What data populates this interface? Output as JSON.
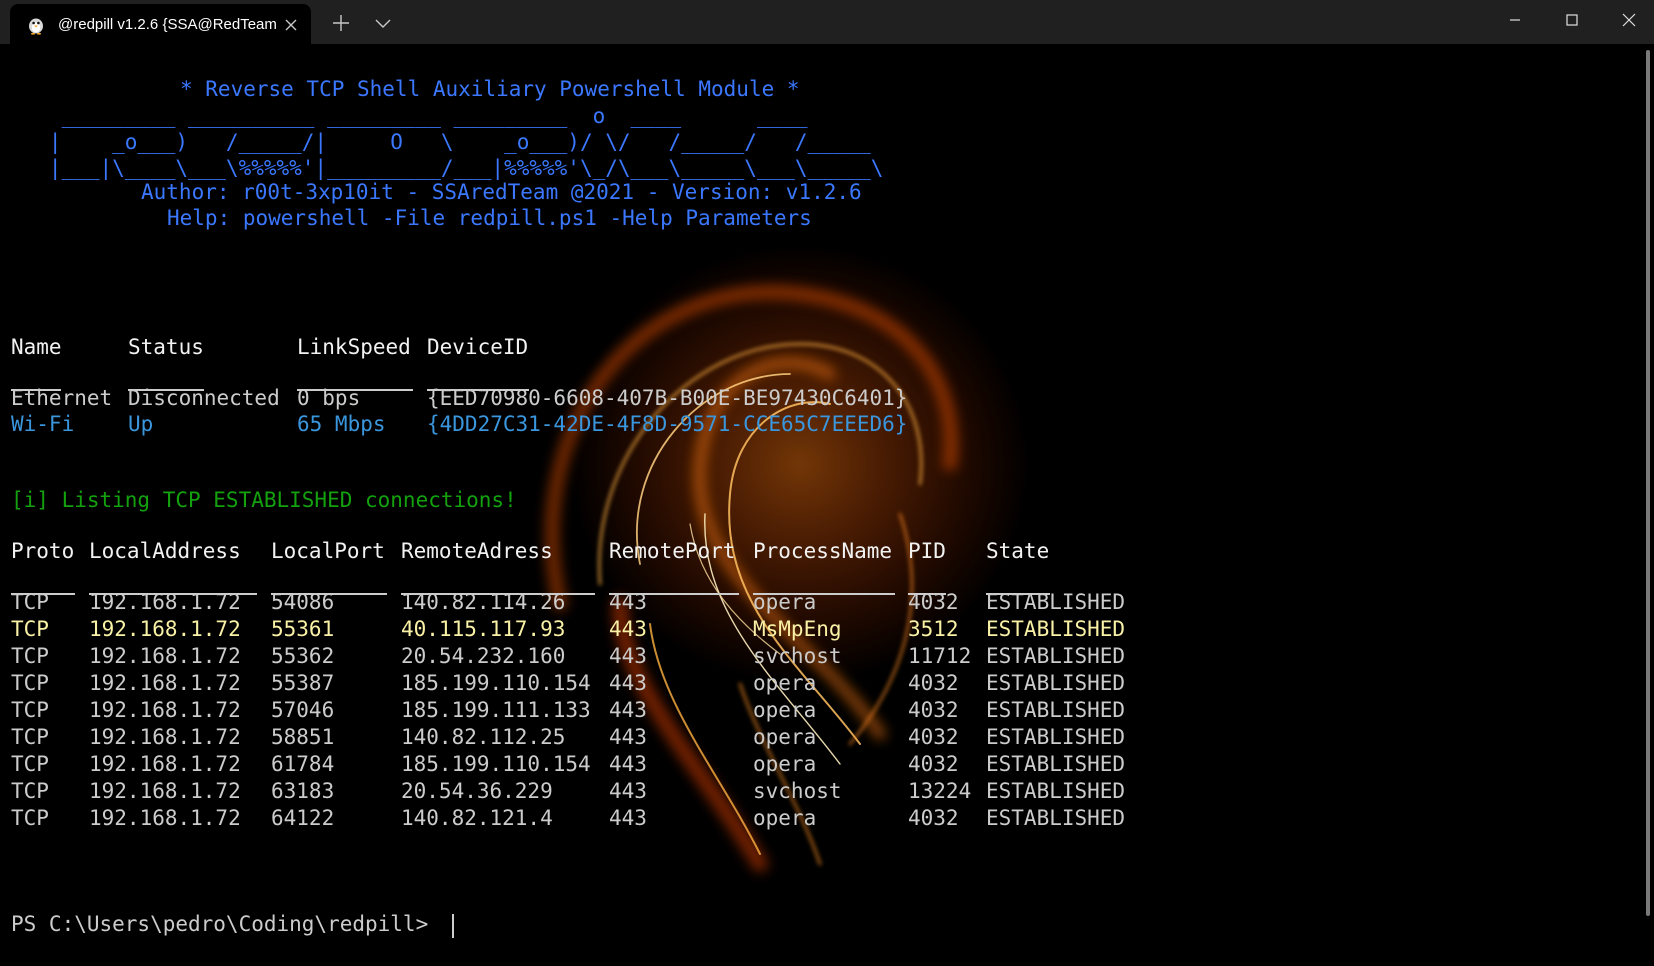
{
  "window": {
    "tab_title": "@redpill v1.2.6 {SSA@RedTeam}",
    "icons": {
      "tab": "penguin-icon",
      "close_tab": "close-icon",
      "new_tab": "plus-icon",
      "dropdown": "chevron-down-icon",
      "minimize": "minimize-icon",
      "maximize": "maximize-icon",
      "close": "close-icon"
    }
  },
  "colors": {
    "title_bar": "#202020",
    "terminal_bg": "#000000",
    "banner_blue": "#3b78ff",
    "wifi_row": "#3a96dd",
    "info_green": "#13a10e",
    "highlight_row": "#f9f1a5",
    "default_text": "#cccccc"
  },
  "banner": {
    "title": "* Reverse TCP Shell Auxiliary Powershell Module *",
    "art": [
      "    _________ __________ _________ _________  o  ____      ____",
      "   |    _o___)   /_____/|     O   \\    _o___)/ \\/   /_____/   /_____",
      "   |___|\\____\\___\\%%%%%'|_________/___|%%%%%'\\_/\\___\\_____\\___\\_____\\"
    ],
    "author": "Author: r00t-3xp10it - SSAredTeam @2021 - Version: v1.2.6",
    "help": "Help: powershell -File redpill.ps1 -Help Parameters"
  },
  "adapters": {
    "columns": [
      "Name",
      "Status",
      "LinkSpeed",
      "DeviceID"
    ],
    "rows": [
      {
        "name": "Ethernet",
        "status": "Disconnected",
        "link_speed": "0 bps",
        "device_id": "{EED70980-6608-407B-B00E-BE97430C6401}"
      },
      {
        "name": "Wi-Fi",
        "status": "Up",
        "link_speed": "65 Mbps",
        "device_id": "{4DD27C31-42DE-4F8D-9571-CCE65C7EEED6}"
      }
    ]
  },
  "info_message": "[i] Listing TCP ESTABLISHED connections!",
  "connections": {
    "columns": [
      "Proto",
      "LocalAddress",
      "LocalPort",
      "RemoteAdress",
      "RemotePort",
      "ProcessName",
      "PID",
      "State"
    ],
    "rows": [
      {
        "proto": "TCP",
        "local_address": "192.168.1.72",
        "local_port": "54086",
        "remote_address": "140.82.114.26",
        "remote_port": "443",
        "process": "opera",
        "pid": "4032",
        "state": "ESTABLISHED"
      },
      {
        "proto": "TCP",
        "local_address": "192.168.1.72",
        "local_port": "55361",
        "remote_address": "40.115.117.93",
        "remote_port": "443",
        "process": "MsMpEng",
        "pid": "3512",
        "state": "ESTABLISHED"
      },
      {
        "proto": "TCP",
        "local_address": "192.168.1.72",
        "local_port": "55362",
        "remote_address": "20.54.232.160",
        "remote_port": "443",
        "process": "svchost",
        "pid": "11712",
        "state": "ESTABLISHED"
      },
      {
        "proto": "TCP",
        "local_address": "192.168.1.72",
        "local_port": "55387",
        "remote_address": "185.199.110.154",
        "remote_port": "443",
        "process": "opera",
        "pid": "4032",
        "state": "ESTABLISHED"
      },
      {
        "proto": "TCP",
        "local_address": "192.168.1.72",
        "local_port": "57046",
        "remote_address": "185.199.111.133",
        "remote_port": "443",
        "process": "opera",
        "pid": "4032",
        "state": "ESTABLISHED"
      },
      {
        "proto": "TCP",
        "local_address": "192.168.1.72",
        "local_port": "58851",
        "remote_address": "140.82.112.25",
        "remote_port": "443",
        "process": "opera",
        "pid": "4032",
        "state": "ESTABLISHED"
      },
      {
        "proto": "TCP",
        "local_address": "192.168.1.72",
        "local_port": "61784",
        "remote_address": "185.199.110.154",
        "remote_port": "443",
        "process": "opera",
        "pid": "4032",
        "state": "ESTABLISHED"
      },
      {
        "proto": "TCP",
        "local_address": "192.168.1.72",
        "local_port": "63183",
        "remote_address": "20.54.36.229",
        "remote_port": "443",
        "process": "svchost",
        "pid": "13224",
        "state": "ESTABLISHED"
      },
      {
        "proto": "TCP",
        "local_address": "192.168.1.72",
        "local_port": "64122",
        "remote_address": "140.82.121.4",
        "remote_port": "443",
        "process": "opera",
        "pid": "4032",
        "state": "ESTABLISHED"
      }
    ]
  },
  "prompt": "PS C:\\Users\\pedro\\Coding\\redpill>"
}
